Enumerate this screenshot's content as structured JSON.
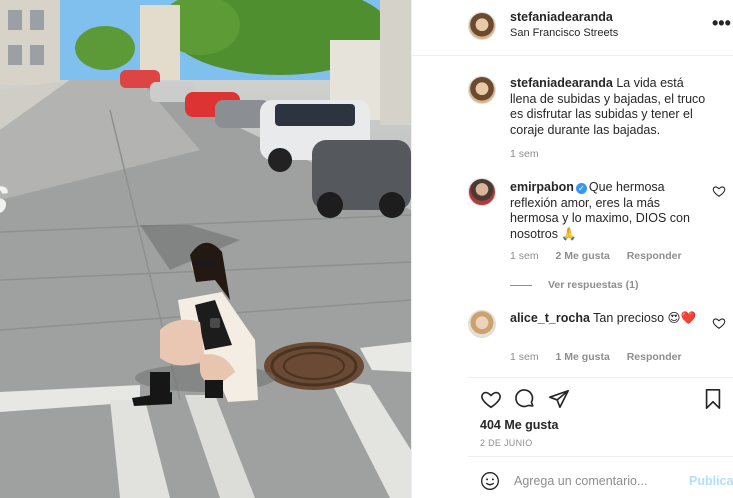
{
  "header": {
    "username": "stefaniadearanda",
    "location": "San Francisco Streets",
    "more_glyph": "•••"
  },
  "caption": {
    "username": "stefaniadearanda",
    "text": "La vida está llena de subidas y bajadas, el truco es disfrutar las subidas y tener el coraje durante las bajadas.",
    "time": "1 sem"
  },
  "comments": [
    {
      "username": "emirpabon",
      "verified": true,
      "text": "Que hermosa reflexión amor, eres la más hermosa y lo maximo, DIOS con nosotros 🙏",
      "time": "1 sem",
      "likes": "2 Me gusta",
      "reply_label": "Responder"
    },
    {
      "username": "alice_t_rocha",
      "verified": false,
      "text": "Tan precioso 😍❤️",
      "time": "1 sem",
      "likes": "1 Me gusta",
      "reply_label": "Responder"
    }
  ],
  "replies": {
    "label": "Ver respuestas (1)"
  },
  "actions": {
    "icons": [
      "heart-icon",
      "comment-icon",
      "share-icon",
      "bookmark-icon"
    ],
    "likes": "404 Me gusta",
    "date": "2 DE JUNIO"
  },
  "composer": {
    "placeholder": "Agrega un comentario...",
    "publish_label": "Publicar"
  },
  "photo": {
    "street_marking": "LS"
  },
  "colors": {
    "accent": "#3897f0",
    "publish_disabled": "#b2dffc",
    "muted": "#8e8e8e"
  }
}
